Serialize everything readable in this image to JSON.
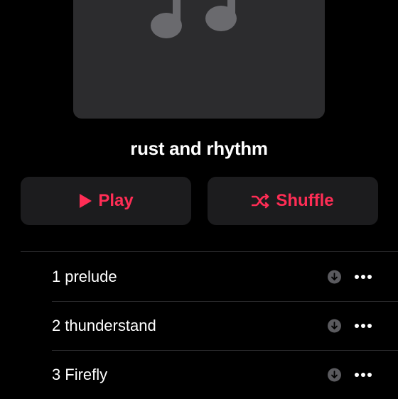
{
  "album": {
    "title": "rust and rhythm",
    "artwork_icon": "music-note-icon"
  },
  "actions": {
    "play_label": "Play",
    "play_icon": "play-icon",
    "shuffle_label": "Shuffle",
    "shuffle_icon": "shuffle-icon"
  },
  "tracks": [
    {
      "number": "1",
      "title": "prelude",
      "download_icon": "download-icon",
      "more_icon": "more-icon"
    },
    {
      "number": "2",
      "title": "thunderstand",
      "download_icon": "download-icon",
      "more_icon": "more-icon"
    },
    {
      "number": "3",
      "title": "Firefly",
      "download_icon": "download-icon",
      "more_icon": "more-icon"
    }
  ],
  "colors": {
    "background": "#000000",
    "accent": "#ff2d55",
    "surface": "#1c1c1e",
    "artwork": "#2c2c2e",
    "icon_gray": "#5a5a5e"
  }
}
